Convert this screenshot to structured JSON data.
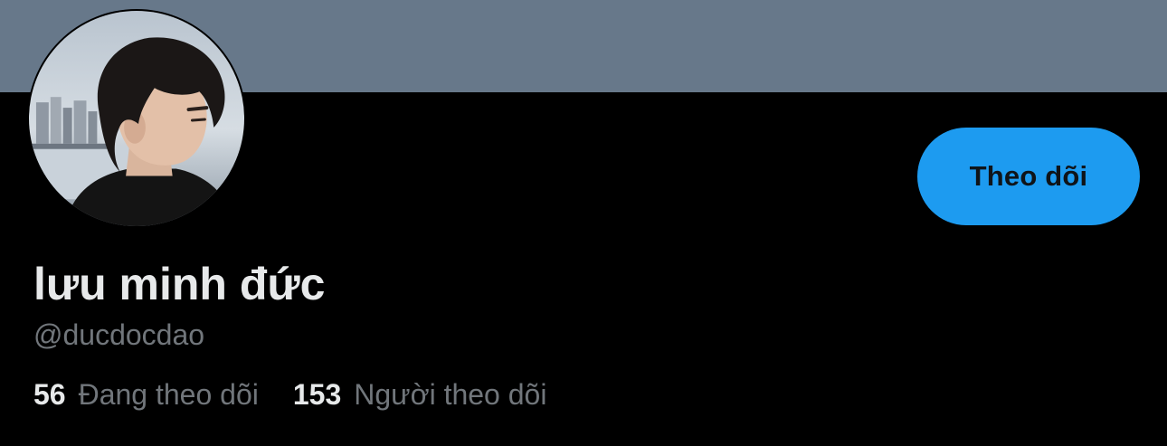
{
  "profile": {
    "display_name": "lưu minh đức",
    "handle": "@ducdocdao",
    "follow_label": "Theo dõi",
    "following_count": "56",
    "following_label": "Đang theo dõi",
    "followers_count": "153",
    "followers_label": "Người theo dõi"
  },
  "colors": {
    "banner": "#67788a",
    "background": "#000000",
    "accent": "#1d9bf0",
    "primary_text": "#e7e9ea",
    "secondary_text": "#71767b"
  }
}
